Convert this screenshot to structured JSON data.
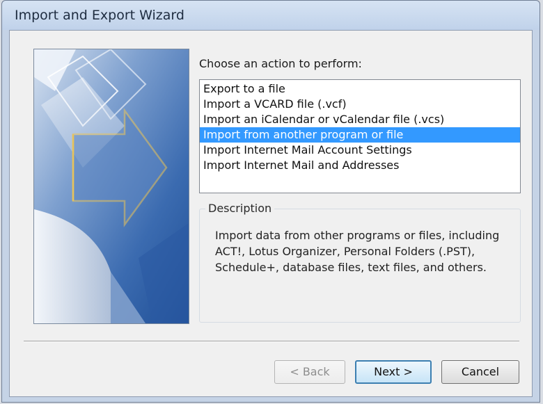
{
  "window": {
    "title": "Import and Export Wizard"
  },
  "prompt": "Choose an action to perform:",
  "actions": [
    {
      "label": "Export to a file",
      "selected": false
    },
    {
      "label": "Import a VCARD file (.vcf)",
      "selected": false
    },
    {
      "label": "Import an iCalendar or vCalendar file (.vcs)",
      "selected": false
    },
    {
      "label": "Import from another program or file",
      "selected": true
    },
    {
      "label": "Import Internet Mail Account Settings",
      "selected": false
    },
    {
      "label": "Import Internet Mail and Addresses",
      "selected": false
    }
  ],
  "description": {
    "legend": "Description",
    "text": "Import data from other programs or files, including ACT!, Lotus Organizer, Personal Folders (.PST), Schedule+, database files, text files, and others."
  },
  "buttons": {
    "back": "< Back",
    "next": "Next >",
    "cancel": "Cancel"
  },
  "colors": {
    "selection": "#3399ff",
    "banner_blue": "#3e6fb0",
    "arrow_outline": "#e8c35a"
  },
  "icons": {
    "banner": "import-export-arrow-banner"
  }
}
